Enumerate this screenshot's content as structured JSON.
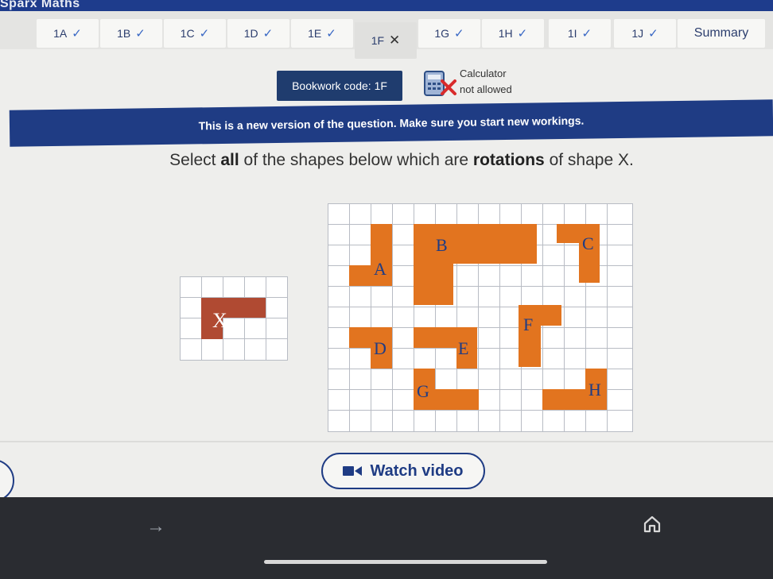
{
  "app": {
    "title": "Sparx Maths"
  },
  "tabs": [
    {
      "label": "1A",
      "status": "correct"
    },
    {
      "label": "1B",
      "status": "correct"
    },
    {
      "label": "1C",
      "status": "correct"
    },
    {
      "label": "1D",
      "status": "correct"
    },
    {
      "label": "1E",
      "status": "correct"
    },
    {
      "label": "1F",
      "status": "incorrect"
    },
    {
      "label": "1G",
      "status": "correct"
    },
    {
      "label": "1H",
      "status": "correct"
    },
    {
      "label": "1I",
      "status": "correct"
    },
    {
      "label": "1J",
      "status": "correct"
    },
    {
      "label": "Summary",
      "status": "none"
    }
  ],
  "bookwork": {
    "label": "Bookwork code: 1F"
  },
  "calculator": {
    "line1": "Calculator",
    "line2": "not allowed"
  },
  "banner": {
    "text": "This is a new version of the question. Make sure you start new workings."
  },
  "question": {
    "prefix": "Select ",
    "emph1": "all",
    "middle": " of the shapes below which are ",
    "emph2": "rotations",
    "suffix": " of shape X."
  },
  "shapes": {
    "x_label": "X",
    "labels": [
      "A",
      "B",
      "C",
      "D",
      "E",
      "F",
      "G",
      "H"
    ]
  },
  "watch_video": {
    "label": "Watch video"
  },
  "colors": {
    "brand": "#1f3c84",
    "shape_orange": "#e2741f",
    "shape_x": "#b04a32",
    "grid_line": "#b8bcc4"
  },
  "icons": {
    "correct": "check-icon",
    "incorrect": "cross-icon",
    "calculator": "calculator-crossed-icon",
    "video": "video-camera-icon",
    "home": "home-icon",
    "forward": "arrow-right-icon"
  }
}
